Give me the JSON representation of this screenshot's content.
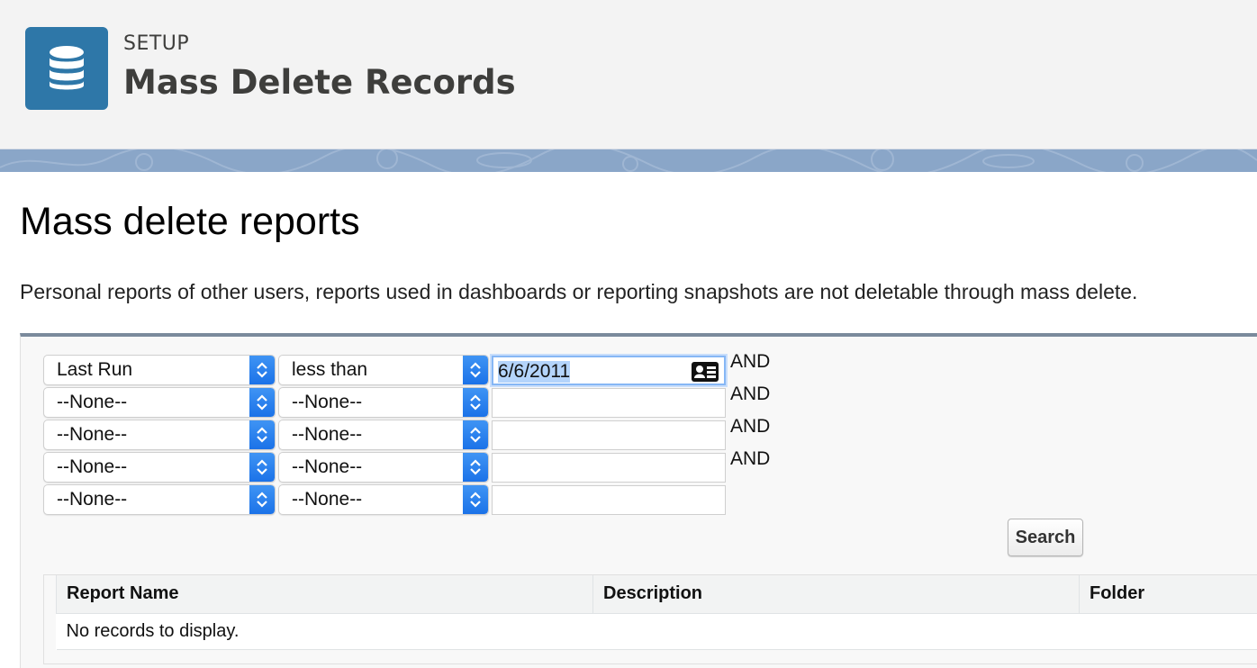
{
  "header": {
    "eyebrow": "SETUP",
    "title": "Mass Delete Records",
    "icon": "database-icon",
    "icon_color": "#2e77a8"
  },
  "main": {
    "title": "Mass delete reports",
    "note": "Personal reports of other users, reports used in dashboards or reporting snapshots are not deletable through mass delete."
  },
  "filters": {
    "rows": [
      {
        "field": "Last Run",
        "operator": "less than",
        "value": "6/6/2011",
        "conjunction": "AND"
      },
      {
        "field": "--None--",
        "operator": "--None--",
        "value": "",
        "conjunction": "AND"
      },
      {
        "field": "--None--",
        "operator": "--None--",
        "value": "",
        "conjunction": "AND"
      },
      {
        "field": "--None--",
        "operator": "--None--",
        "value": "",
        "conjunction": "AND"
      },
      {
        "field": "--None--",
        "operator": "--None--",
        "value": "",
        "conjunction": ""
      }
    ],
    "search_label": "Search"
  },
  "results": {
    "columns": [
      "Report Name",
      "Description",
      "Folder"
    ],
    "empty_message": "No records to display."
  }
}
